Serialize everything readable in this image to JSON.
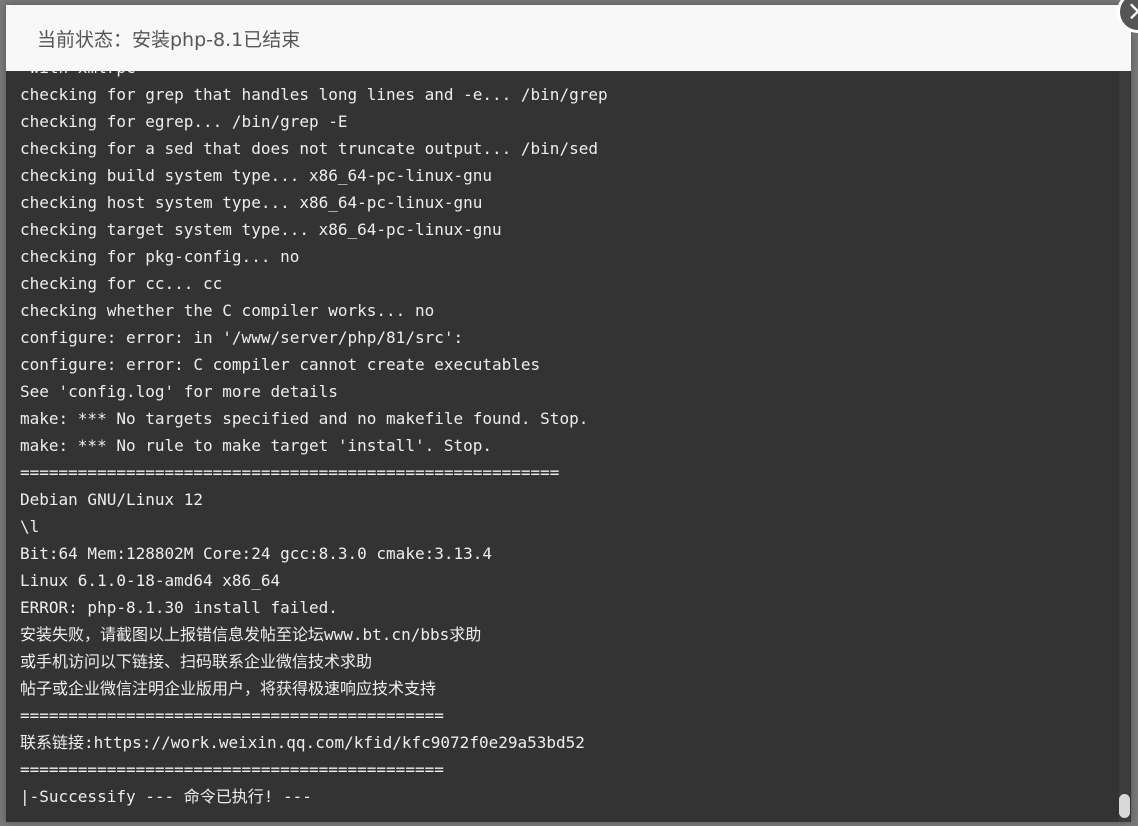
{
  "dialog": {
    "title": "当前状态：安装php-8.1已结束",
    "close_icon": "close-icon"
  },
  "log": {
    "lines": [
      " with xmlrpc",
      "checking for grep that handles long lines and -e... /bin/grep",
      "checking for egrep... /bin/grep -E",
      "checking for a sed that does not truncate output... /bin/sed",
      "checking build system type... x86_64-pc-linux-gnu",
      "checking host system type... x86_64-pc-linux-gnu",
      "checking target system type... x86_64-pc-linux-gnu",
      "checking for pkg-config... no",
      "checking for cc... cc",
      "checking whether the C compiler works... no",
      "configure: error: in '/www/server/php/81/src':",
      "configure: error: C compiler cannot create executables",
      "See 'config.log' for more details",
      "make: *** No targets specified and no makefile found. Stop.",
      "make: *** No rule to make target 'install'. Stop.",
      "========================================================",
      "Debian GNU/Linux 12",
      "\\l",
      "Bit:64 Mem:128802M Core:24 gcc:8.3.0 cmake:3.13.4",
      "Linux 6.1.0-18-amd64 x86_64",
      "ERROR: php-8.1.30 install failed.",
      "安装失败，请截图以上报错信息发帖至论坛www.bt.cn/bbs求助",
      "或手机访问以下链接、扫码联系企业微信技术求助",
      "帖子或企业微信注明企业版用户，将获得极速响应技术支持",
      "============================================",
      "联系链接:https://work.weixin.qq.com/kfid/kfc9072f0e29a53bd52",
      "============================================",
      "|-Successify --- 命令已执行! ---"
    ]
  }
}
